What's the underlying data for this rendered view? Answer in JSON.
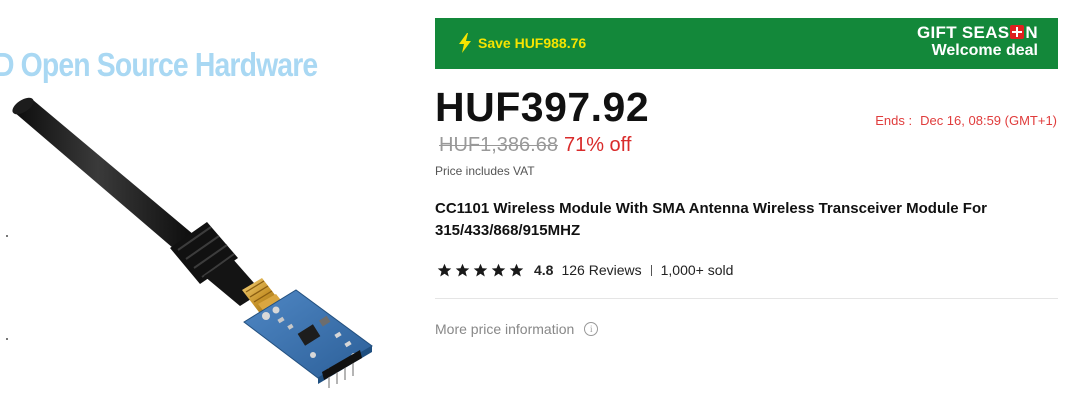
{
  "image": {
    "watermark": "D Open Source Hardware",
    "alt": "CC1101 module with SMA antenna"
  },
  "banner": {
    "save_label": "Save HUF988.76",
    "gift_line1_a": "GIFT SEAS",
    "gift_line1_b": "N",
    "gift_line2": "Welcome deal",
    "bg_color": "#13883a",
    "save_color": "#f6e400"
  },
  "price": {
    "current": "HUF397.92",
    "original": "HUF1,386.68",
    "discount": "71% off",
    "vat_note": "Price includes VAT",
    "ends_label": "Ends :",
    "ends_value": "Dec 16, 08:59 (GMT+1)"
  },
  "product": {
    "title": "CC1101 Wireless Module With SMA Antenna Wireless Transceiver Module For 315/433/868/915MHZ"
  },
  "rating": {
    "stars": 5,
    "value": "4.8",
    "reviews": "126 Reviews",
    "sold": "1,000+ sold"
  },
  "more_info": {
    "label": "More price information",
    "icon": "info-icon"
  }
}
